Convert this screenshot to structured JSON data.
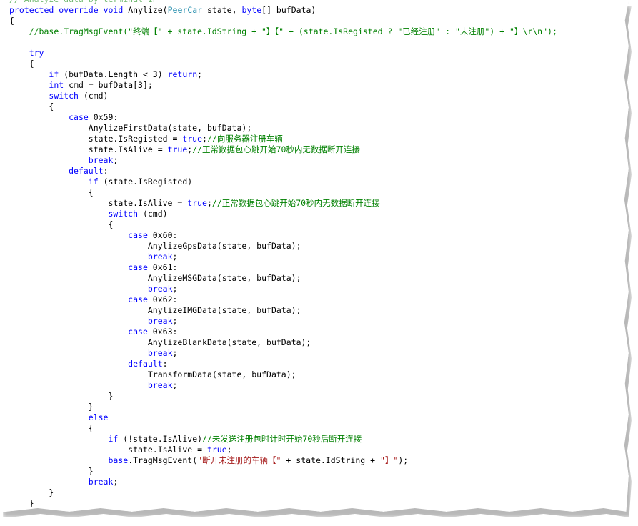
{
  "lines": [
    [
      {
        "t": "// Analyze data by terminal IP",
        "c": "cm cut"
      }
    ],
    [
      {
        "t": "protected",
        "c": "kw"
      },
      {
        "t": " "
      },
      {
        "t": "override",
        "c": "kw"
      },
      {
        "t": " "
      },
      {
        "t": "void",
        "c": "kw"
      },
      {
        "t": " Anylize("
      },
      {
        "t": "PeerCar",
        "c": "ty"
      },
      {
        "t": " state, "
      },
      {
        "t": "byte",
        "c": "kw"
      },
      {
        "t": "[] bufData)"
      }
    ],
    [
      {
        "t": "{"
      }
    ],
    [
      {
        "t": "    "
      },
      {
        "t": "//base.TragMsgEvent(\"终端【\" + state.IdString + \"】【\" + (state.IsRegisted ? \"已经注册\" : \"未注册\") + \"】\\r\\n\");",
        "c": "cm"
      }
    ],
    [
      {
        "t": ""
      }
    ],
    [
      {
        "t": "    "
      },
      {
        "t": "try",
        "c": "kw"
      }
    ],
    [
      {
        "t": "    {"
      }
    ],
    [
      {
        "t": "        "
      },
      {
        "t": "if",
        "c": "kw"
      },
      {
        "t": " (bufData.Length < 3) "
      },
      {
        "t": "return",
        "c": "kw"
      },
      {
        "t": ";"
      }
    ],
    [
      {
        "t": "        "
      },
      {
        "t": "int",
        "c": "kw"
      },
      {
        "t": " cmd = bufData[3];"
      }
    ],
    [
      {
        "t": "        "
      },
      {
        "t": "switch",
        "c": "kw"
      },
      {
        "t": " (cmd)"
      }
    ],
    [
      {
        "t": "        {"
      }
    ],
    [
      {
        "t": "            "
      },
      {
        "t": "case",
        "c": "kw"
      },
      {
        "t": " 0x59:"
      }
    ],
    [
      {
        "t": "                AnylizeFirstData(state, bufData);"
      }
    ],
    [
      {
        "t": "                state.IsRegisted = "
      },
      {
        "t": "true",
        "c": "kw"
      },
      {
        "t": ";"
      },
      {
        "t": "//向服务器注册车辆",
        "c": "cm"
      }
    ],
    [
      {
        "t": "                state.IsAlive = "
      },
      {
        "t": "true",
        "c": "kw"
      },
      {
        "t": ";"
      },
      {
        "t": "//正常数据包心跳开始70秒内无数据断开连接",
        "c": "cm"
      }
    ],
    [
      {
        "t": "                "
      },
      {
        "t": "break",
        "c": "kw"
      },
      {
        "t": ";"
      }
    ],
    [
      {
        "t": "            "
      },
      {
        "t": "default",
        "c": "kw"
      },
      {
        "t": ":"
      }
    ],
    [
      {
        "t": "                "
      },
      {
        "t": "if",
        "c": "kw"
      },
      {
        "t": " (state.IsRegisted)"
      }
    ],
    [
      {
        "t": "                {"
      }
    ],
    [
      {
        "t": "                    state.IsAlive = "
      },
      {
        "t": "true",
        "c": "kw"
      },
      {
        "t": ";"
      },
      {
        "t": "//正常数据包心跳开始70秒内无数据断开连接",
        "c": "cm"
      }
    ],
    [
      {
        "t": "                    "
      },
      {
        "t": "switch",
        "c": "kw"
      },
      {
        "t": " (cmd)"
      }
    ],
    [
      {
        "t": "                    {"
      }
    ],
    [
      {
        "t": "                        "
      },
      {
        "t": "case",
        "c": "kw"
      },
      {
        "t": " 0x60:"
      }
    ],
    [
      {
        "t": "                            AnylizeGpsData(state, bufData);"
      }
    ],
    [
      {
        "t": "                            "
      },
      {
        "t": "break",
        "c": "kw"
      },
      {
        "t": ";"
      }
    ],
    [
      {
        "t": "                        "
      },
      {
        "t": "case",
        "c": "kw"
      },
      {
        "t": " 0x61:"
      }
    ],
    [
      {
        "t": "                            AnylizeMSGData(state, bufData);"
      }
    ],
    [
      {
        "t": "                            "
      },
      {
        "t": "break",
        "c": "kw"
      },
      {
        "t": ";"
      }
    ],
    [
      {
        "t": "                        "
      },
      {
        "t": "case",
        "c": "kw"
      },
      {
        "t": " 0x62:"
      }
    ],
    [
      {
        "t": "                            AnylizeIMGData(state, bufData);"
      }
    ],
    [
      {
        "t": "                            "
      },
      {
        "t": "break",
        "c": "kw"
      },
      {
        "t": ";"
      }
    ],
    [
      {
        "t": "                        "
      },
      {
        "t": "case",
        "c": "kw"
      },
      {
        "t": " 0x63:"
      }
    ],
    [
      {
        "t": "                            AnylizeBlankData(state, bufData);"
      }
    ],
    [
      {
        "t": "                            "
      },
      {
        "t": "break",
        "c": "kw"
      },
      {
        "t": ";"
      }
    ],
    [
      {
        "t": "                        "
      },
      {
        "t": "default",
        "c": "kw"
      },
      {
        "t": ":"
      }
    ],
    [
      {
        "t": "                            TransformData(state, bufData);"
      }
    ],
    [
      {
        "t": "                            "
      },
      {
        "t": "break",
        "c": "kw"
      },
      {
        "t": ";"
      }
    ],
    [
      {
        "t": "                    }"
      }
    ],
    [
      {
        "t": "                }"
      }
    ],
    [
      {
        "t": "                "
      },
      {
        "t": "else",
        "c": "kw"
      }
    ],
    [
      {
        "t": "                {"
      }
    ],
    [
      {
        "t": "                    "
      },
      {
        "t": "if",
        "c": "kw"
      },
      {
        "t": " (!state.IsAlive)"
      },
      {
        "t": "//未发送注册包时计时开始70秒后断开连接",
        "c": "cm"
      }
    ],
    [
      {
        "t": "                        state.IsAlive = "
      },
      {
        "t": "true",
        "c": "kw"
      },
      {
        "t": ";"
      }
    ],
    [
      {
        "t": "                    "
      },
      {
        "t": "base",
        "c": "kw"
      },
      {
        "t": ".TragMsgEvent("
      },
      {
        "t": "\"断开未注册的车辆【\"",
        "c": "st"
      },
      {
        "t": " + state.IdString + "
      },
      {
        "t": "\"】\"",
        "c": "st"
      },
      {
        "t": ");"
      }
    ],
    [
      {
        "t": "                }"
      }
    ],
    [
      {
        "t": "                "
      },
      {
        "t": "break",
        "c": "kw"
      },
      {
        "t": ";"
      }
    ],
    [
      {
        "t": "        }"
      }
    ],
    [
      {
        "t": "    }"
      }
    ]
  ],
  "colors": {
    "keyword": "#0000ff",
    "type": "#2b91af",
    "comment": "#008000",
    "string": "#a31515",
    "text": "#000000",
    "background": "#ffffff"
  }
}
